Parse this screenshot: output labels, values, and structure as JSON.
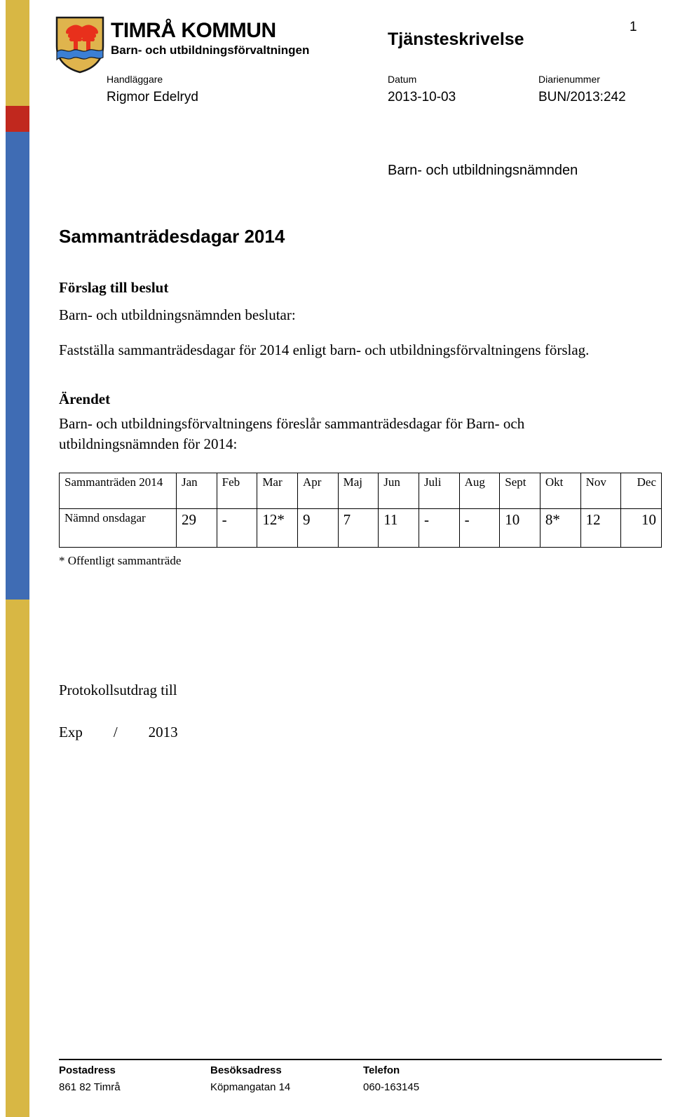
{
  "colors": {
    "band_gold": "#d8b744",
    "band_red": "#c1281e",
    "band_blue": "#3f6cb4",
    "crest_field": "#dfb44d",
    "crest_tree": "#e8301c",
    "crest_water": "#3b7fd4",
    "crest_outline": "#1a1a1a"
  },
  "header": {
    "logo": {
      "crest_icon": "timra-coat-of-arms-icon",
      "org_name": "TIMRÅ KOMMUN",
      "dept_name": "Barn- och utbildningsförvaltningen"
    },
    "doc_type": "Tjänsteskrivelse",
    "page_number": "1",
    "meta": {
      "handlaggare_label": "Handläggare",
      "handlaggare_value": "Rigmor Edelryd",
      "datum_label": "Datum",
      "datum_value": "2013-10-03",
      "diarienummer_label": "Diarienummer",
      "diarienummer_value": "BUN/2013:242"
    }
  },
  "body": {
    "recipient": "Barn- och utbildningsnämnden",
    "title": "Sammanträdesdagar 2014",
    "proposal_heading": "Förslag till beslut",
    "proposal_intro": "Barn- och utbildningsnämnden beslutar:",
    "proposal_text": "Fastställa sammanträdesdagar för 2014 enligt barn- och utbildningsförvaltningens förslag.",
    "case_heading": "Ärendet",
    "case_text_line1": "Barn- och utbildningsförvaltningens föreslår sammanträdesdagar för Barn- och",
    "case_text_line2": "utbildningsnämnden för 2014:",
    "footnote": "* Offentligt sammanträde",
    "protokoll_text": "Protokollsutdrag till",
    "exp_label": "Exp",
    "exp_separator": "/",
    "exp_year": "2013"
  },
  "table": {
    "row_label_1": "Sammanträden 2014",
    "row_label_2": "Nämnd onsdagar",
    "months": [
      "Jan",
      "Feb",
      "Mar",
      "Apr",
      "Maj",
      "Jun",
      "Juli",
      "Aug",
      "Sept",
      "Okt",
      "Nov",
      "Dec"
    ],
    "days": [
      "29",
      "-",
      "12*",
      "9",
      "7",
      "11",
      "-",
      "-",
      "10",
      "8*",
      "12",
      "10"
    ]
  },
  "footer": {
    "postadress_label": "Postadress",
    "postadress_value": "861 82 Timrå",
    "besoksadress_label": "Besöksadress",
    "besoksadress_value": "Köpmangatan 14",
    "telefon_label": "Telefon",
    "telefon_value": "060-163145"
  }
}
